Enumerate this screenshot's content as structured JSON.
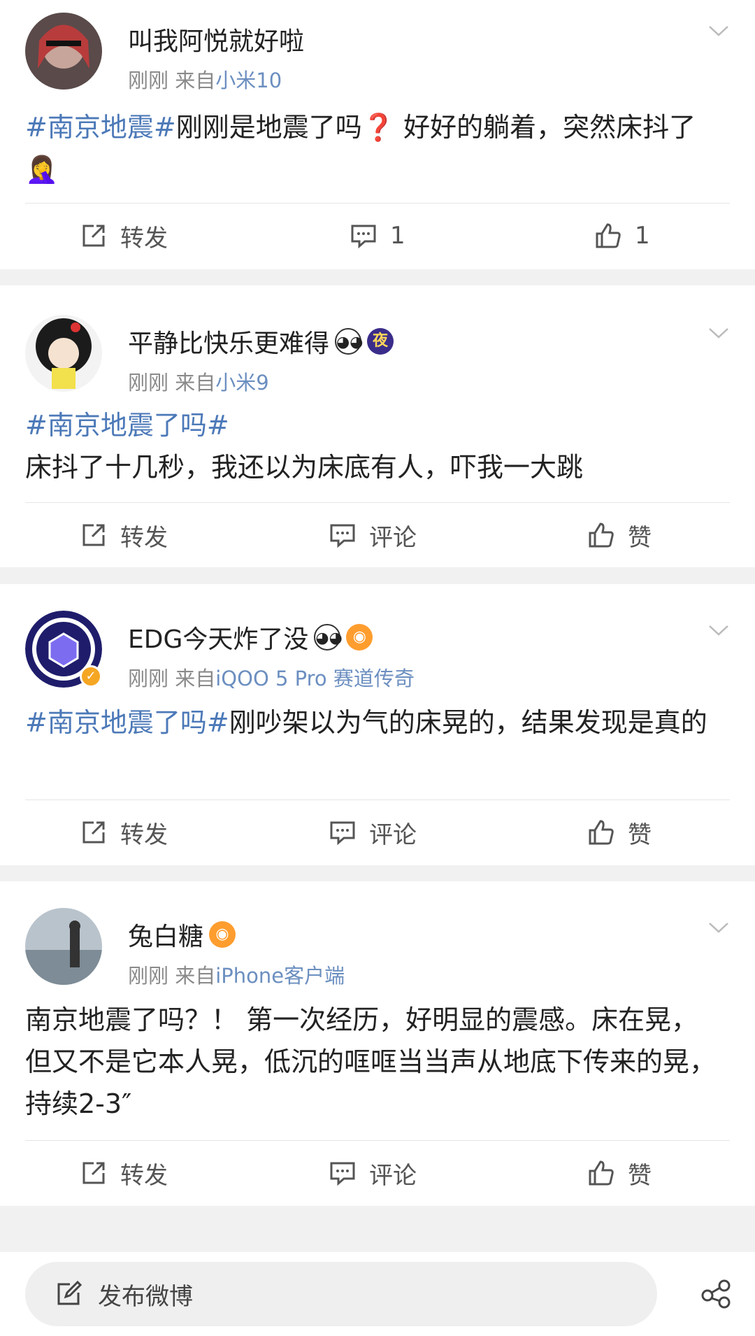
{
  "posts": [
    {
      "username": "叫我阿悦就好啦",
      "time": "刚刚",
      "from_prefix": "来自",
      "source": "小米10",
      "content_tag": "#南京地震#",
      "content_text": "刚刚是地震了吗❓ 好好的躺着，突然床抖了🤦‍♀️",
      "actions": {
        "repost": "转发",
        "comment": "1",
        "like": "1"
      }
    },
    {
      "username": "平静比快乐更难得",
      "badge_night": "夜",
      "time": "刚刚",
      "from_prefix": "来自",
      "source": "小米9",
      "content_tag": "#南京地震了吗#",
      "content_text": "床抖了十几秒，我还以为床底有人，吓我一大跳",
      "actions": {
        "repost": "转发",
        "comment": "评论",
        "like": "赞"
      }
    },
    {
      "username": "EDG今天炸了没",
      "time": "刚刚",
      "from_prefix": "来自",
      "source": "iQOO 5 Pro 赛道传奇",
      "content_tag": "#南京地震了吗#",
      "content_text": "刚吵架以为气的床晃的，结果发现是真的",
      "actions": {
        "repost": "转发",
        "comment": "评论",
        "like": "赞"
      }
    },
    {
      "username": "兔白糖",
      "time": "刚刚",
      "from_prefix": "来自",
      "source": "iPhone客户端",
      "content_tag": "",
      "content_text": "南京地震了吗？！ 第一次经历，好明显的震感。床在晃，但又不是它本人晃，低沉的哐哐当当声从地底下传来的晃，持续2-3″",
      "actions": {
        "repost": "转发",
        "comment": "评论",
        "like": "赞"
      }
    }
  ],
  "bottom_bar": {
    "compose_label": "发布微博"
  },
  "colors": {
    "link": "#4c79b8",
    "source": "#6c8fc0",
    "background": "#f1f1f1"
  }
}
